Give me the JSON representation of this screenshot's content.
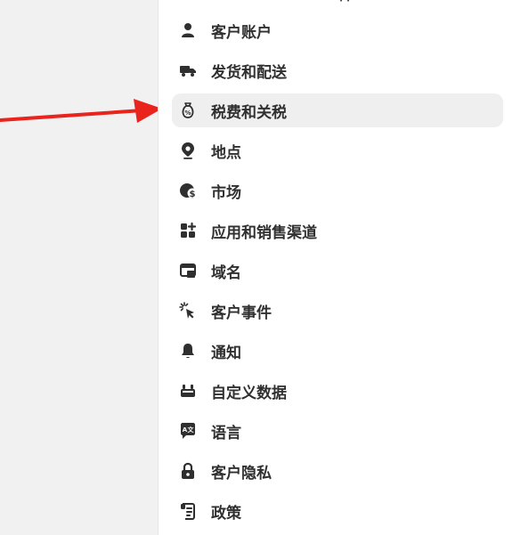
{
  "settings_nav": {
    "items": [
      {
        "label": "客户账户",
        "icon": "person-icon"
      },
      {
        "label": "发货和配送",
        "icon": "truck-icon"
      },
      {
        "label": "税费和关税",
        "icon": "money-bag-icon",
        "active": true
      },
      {
        "label": "地点",
        "icon": "location-pin-icon"
      },
      {
        "label": "市场",
        "icon": "globe-dollar-icon"
      },
      {
        "label": "应用和销售渠道",
        "icon": "apps-icon"
      },
      {
        "label": "域名",
        "icon": "domain-icon"
      },
      {
        "label": "客户事件",
        "icon": "click-cursor-icon"
      },
      {
        "label": "通知",
        "icon": "bell-icon"
      },
      {
        "label": "自定义数据",
        "icon": "data-icon"
      },
      {
        "label": "语言",
        "icon": "translate-icon"
      },
      {
        "label": "客户隐私",
        "icon": "lock-icon"
      },
      {
        "label": "政策",
        "icon": "policy-scroll-icon"
      }
    ]
  },
  "annotation": {
    "arrow_color": "#e8241c"
  },
  "colors": {
    "active_background": "#efefef",
    "text": "#303030"
  }
}
